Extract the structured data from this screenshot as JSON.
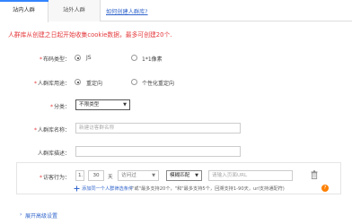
{
  "tabs": {
    "active": "站内人群",
    "second": "站外人群",
    "help_link": "如何创建人群库?"
  },
  "notice": "人群库从创建之日起开始收集cookie数据，最多可创建20个.",
  "form": {
    "code_type": {
      "label": "布码类型：",
      "options": [
        "JS",
        "1*1像素"
      ],
      "selected": "JS"
    },
    "usage": {
      "label": "人群库用途：",
      "options": [
        "重定向",
        "个性化重定向"
      ],
      "selected": "重定向"
    },
    "category": {
      "label": "分类：",
      "value": "不限类型"
    },
    "name": {
      "label": "人群库名称：",
      "placeholder": "新建访客群名称"
    },
    "description": {
      "label": "人群库描述："
    },
    "visit": {
      "label": "访客行为：",
      "index": "1.",
      "days": "30",
      "days_unit": "天",
      "action": "访问过",
      "match": "模糊匹配",
      "url_placeholder": "请输入页面URL"
    },
    "add_condition": {
      "link": "添加同一个人群筛选条件",
      "hint": "(\"或\"最多支持20个，\"和\"最多支持5个，回溯支持1-90天，url支持通配符)"
    }
  },
  "advanced": "展开高级设置",
  "colors": {
    "accent": "#3385ff",
    "warning": "#e4393c",
    "link": "#3366cc",
    "help": "#ff7f00"
  },
  "icons": [
    "radio-icon",
    "chevron-down-icon",
    "trash-icon",
    "plus-icon",
    "question-icon"
  ]
}
